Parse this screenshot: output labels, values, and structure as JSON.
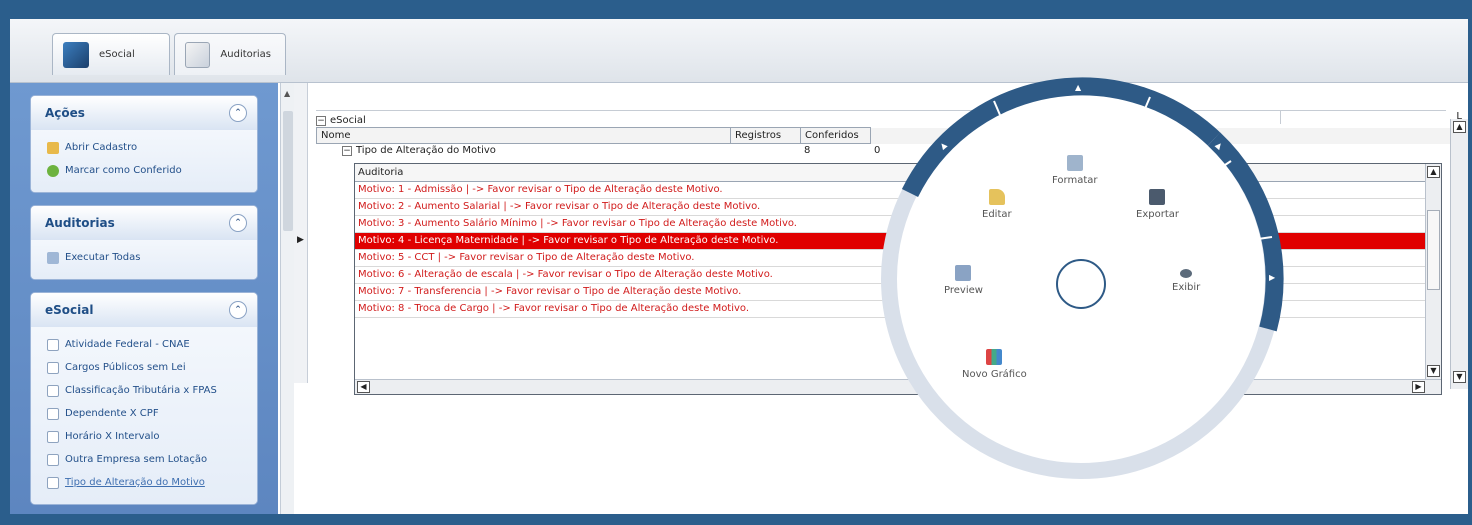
{
  "tabs": [
    {
      "label": "eSocial"
    },
    {
      "label": "Auditorias"
    }
  ],
  "sidebar": {
    "acoes": {
      "title": "Ações",
      "items": [
        "Abrir Cadastro",
        "Marcar como Conferido"
      ]
    },
    "auditorias": {
      "title": "Auditorias",
      "items": [
        "Executar Todas"
      ]
    },
    "esocial": {
      "title": "eSocial",
      "items": [
        "Atividade Federal - CNAE",
        "Cargos Públicos sem Lei",
        "Classificação Tributária x FPAS",
        "Dependente X CPF",
        "Horário X Intervalo",
        "Outra Empresa sem Lotação",
        "Tipo de Alteração do Motivo"
      ]
    }
  },
  "grid": {
    "root": "eSocial",
    "columns": {
      "nome": "Nome",
      "registros": "Registros",
      "conferidos": "Conferidos"
    },
    "group": {
      "label": "Tipo de Alteração do Motivo",
      "registros": "8",
      "conferidos": "0"
    },
    "inner_header": "Auditoria",
    "rows": [
      "Motivo: 1 - Admissão |  -> Favor revisar o Tipo de Alteração deste Motivo.",
      "Motivo: 2 - Aumento Salarial |  -> Favor revisar o Tipo de Alteração deste Motivo.",
      "Motivo: 3 - Aumento Salário Mínimo |  -> Favor revisar o Tipo de Alteração deste Motivo.",
      "Motivo: 4 - Licença Maternidade |  -> Favor revisar o Tipo de Alteração deste Motivo.",
      "Motivo: 5 - CCT |  -> Favor revisar o Tipo de Alteração deste Motivo.",
      "Motivo: 6 - Alteração de escala |  -> Favor revisar o Tipo de Alteração deste Motivo.",
      "Motivo: 7 - Transferencia |  -> Favor revisar o Tipo de Alteração deste Motivo.",
      "Motivo: 8 - Troca de Cargo |  -> Favor revisar o Tipo de Alteração deste Motivo."
    ],
    "selected_row": 3,
    "corner_label": "L"
  },
  "radial_menu": {
    "items": {
      "formatar": "Formatar",
      "editar": "Editar",
      "exportar": "Exportar",
      "preview": "Preview",
      "exibir": "Exibir",
      "novo_grafico": "Novo Gráfico"
    }
  },
  "colors": {
    "background": "#2b5e8c",
    "sidebar": "#6f99d0",
    "error_text": "#d11b1b",
    "selected_row": "#e00000",
    "radial_ring": "#2e5a86"
  }
}
